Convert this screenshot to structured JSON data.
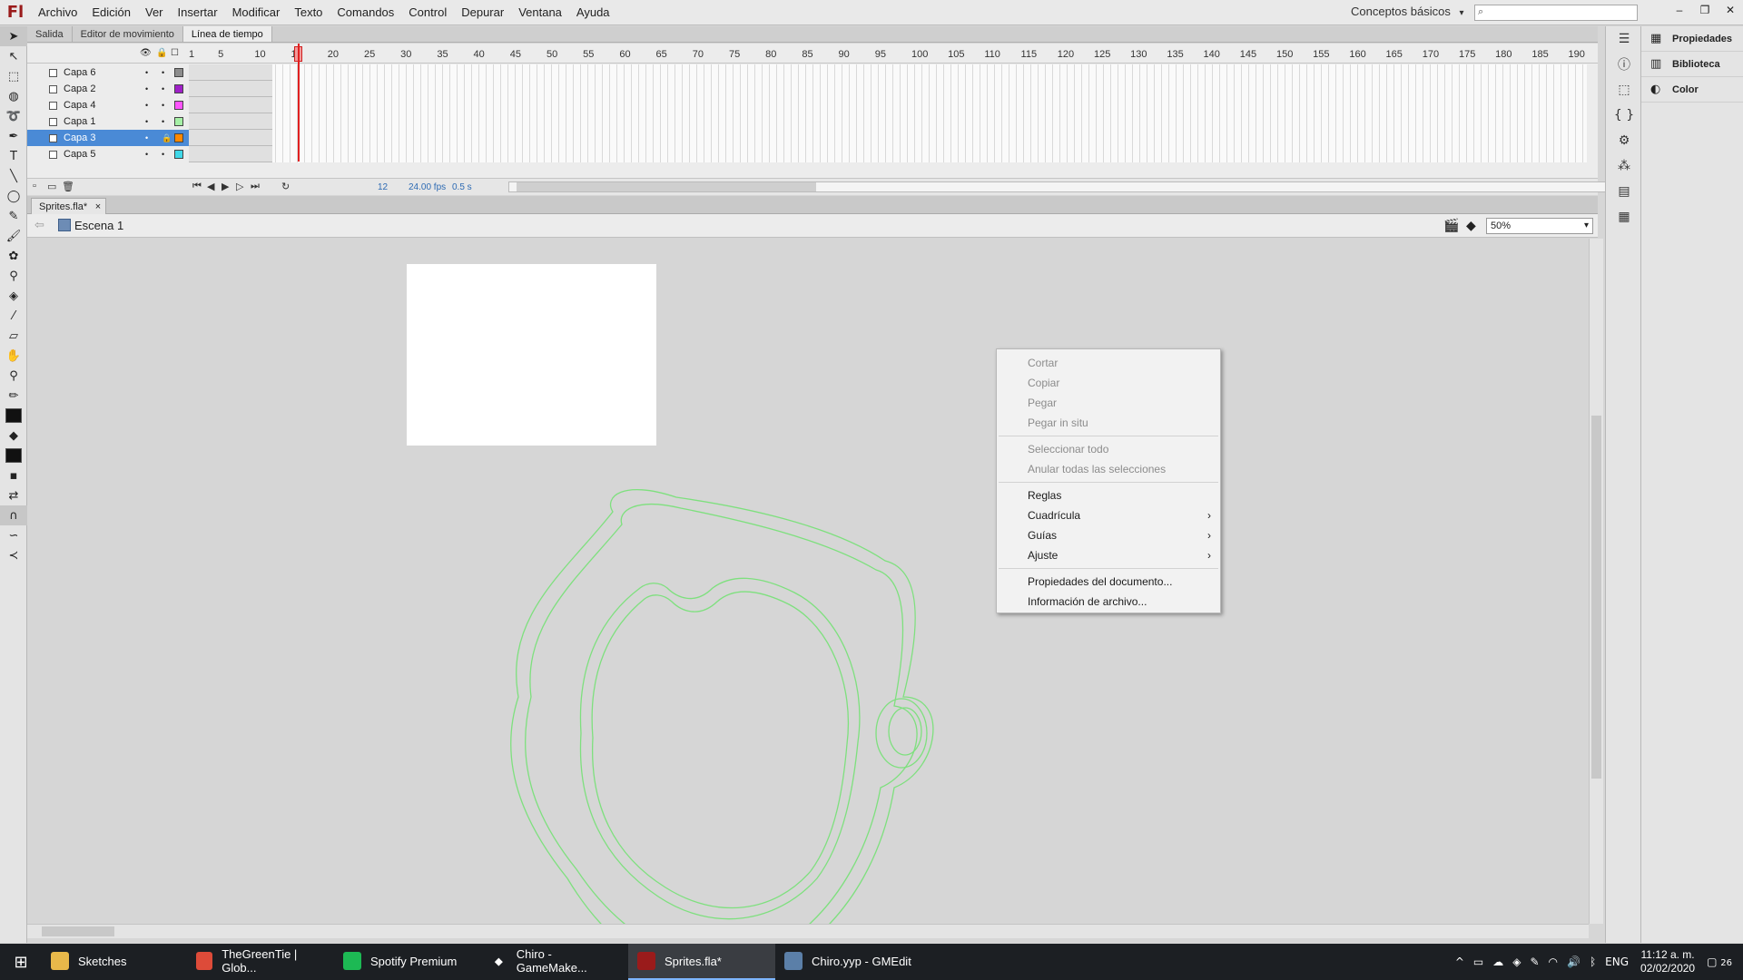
{
  "app": {
    "logo": "Fl",
    "menus": [
      "Archivo",
      "Edición",
      "Ver",
      "Insertar",
      "Modificar",
      "Texto",
      "Comandos",
      "Control",
      "Depurar",
      "Ventana",
      "Ayuda"
    ],
    "workspace": "Conceptos básicos",
    "workspace_arrow": "▾"
  },
  "panel_tabs": [
    "Salida",
    "Editor de movimiento",
    "Línea de tiempo"
  ],
  "timeline": {
    "frame_numbers": [
      "1",
      "5",
      "10",
      "15",
      "20",
      "25",
      "30",
      "35",
      "40",
      "45",
      "50",
      "55",
      "60",
      "65",
      "70",
      "75",
      "80",
      "85",
      "90",
      "95",
      "100",
      "105",
      "110",
      "115",
      "120",
      "125",
      "130",
      "135",
      "140",
      "145",
      "150",
      "155",
      "160",
      "165",
      "170",
      "175",
      "180",
      "185",
      "190"
    ],
    "layers": [
      {
        "name": "Capa 6",
        "color": "#8c8c8c",
        "selected": false
      },
      {
        "name": "Capa 2",
        "color": "#a020c8",
        "selected": false
      },
      {
        "name": "Capa 4",
        "color": "#ff55ff",
        "selected": false
      },
      {
        "name": "Capa 1",
        "color": "#a6f0a6",
        "selected": false
      },
      {
        "name": "Capa 3",
        "color": "#ff8800",
        "selected": true
      },
      {
        "name": "Capa 5",
        "color": "#40d8e8",
        "selected": false
      }
    ],
    "current_frame": "12",
    "fps": "24.00 fps",
    "time": "0.5 s"
  },
  "document": {
    "tab_title": "Sprites.fla*",
    "scene": "Escena 1",
    "zoom": "50%"
  },
  "right_panel": {
    "items": [
      "Propiedades",
      "Biblioteca",
      "Color"
    ]
  },
  "context_menu": {
    "items": [
      {
        "label": "Cortar",
        "enabled": false
      },
      {
        "label": "Copiar",
        "enabled": false
      },
      {
        "label": "Pegar",
        "enabled": false
      },
      {
        "label": "Pegar in situ",
        "enabled": false
      },
      {
        "label": "Seleccionar todo",
        "enabled": false
      },
      {
        "label": "Anular todas las selecciones",
        "enabled": false
      },
      {
        "label": "Reglas",
        "enabled": true
      },
      {
        "label": "Cuadrícula",
        "enabled": true,
        "submenu": true
      },
      {
        "label": "Guías",
        "enabled": true,
        "submenu": true
      },
      {
        "label": "Ajuste",
        "enabled": true,
        "submenu": true
      },
      {
        "label": "Propiedades del documento...",
        "enabled": true
      },
      {
        "label": "Información de archivo...",
        "enabled": true
      }
    ],
    "submenu_arrow": "›"
  },
  "taskbar": {
    "tasks": [
      {
        "label": "Sketches",
        "icon": "folder-icon",
        "color": "#e8b84a"
      },
      {
        "label": "TheGreenTie | Glob...",
        "icon": "chrome-icon",
        "color": "#dd4b39"
      },
      {
        "label": "Spotify Premium",
        "icon": "spotify-icon",
        "color": "#1db954"
      },
      {
        "label": "Chiro - GameMake...",
        "icon": "gamemaker-icon",
        "color": "#ffffff"
      },
      {
        "label": "Sprites.fla*",
        "icon": "flash-icon",
        "color": "#9a1b1b"
      },
      {
        "label": "Chiro.yyp - GMEdit",
        "icon": "gmedit-icon",
        "color": "#5b7fa8"
      }
    ],
    "lang": "ENG",
    "time": "11:12 a. m.",
    "date": "02/02/2020",
    "notifications": "26"
  },
  "colors": {
    "selection": "#4a8ad6",
    "sketch_stroke": "#7ee07e",
    "playhead": "#e02020"
  }
}
